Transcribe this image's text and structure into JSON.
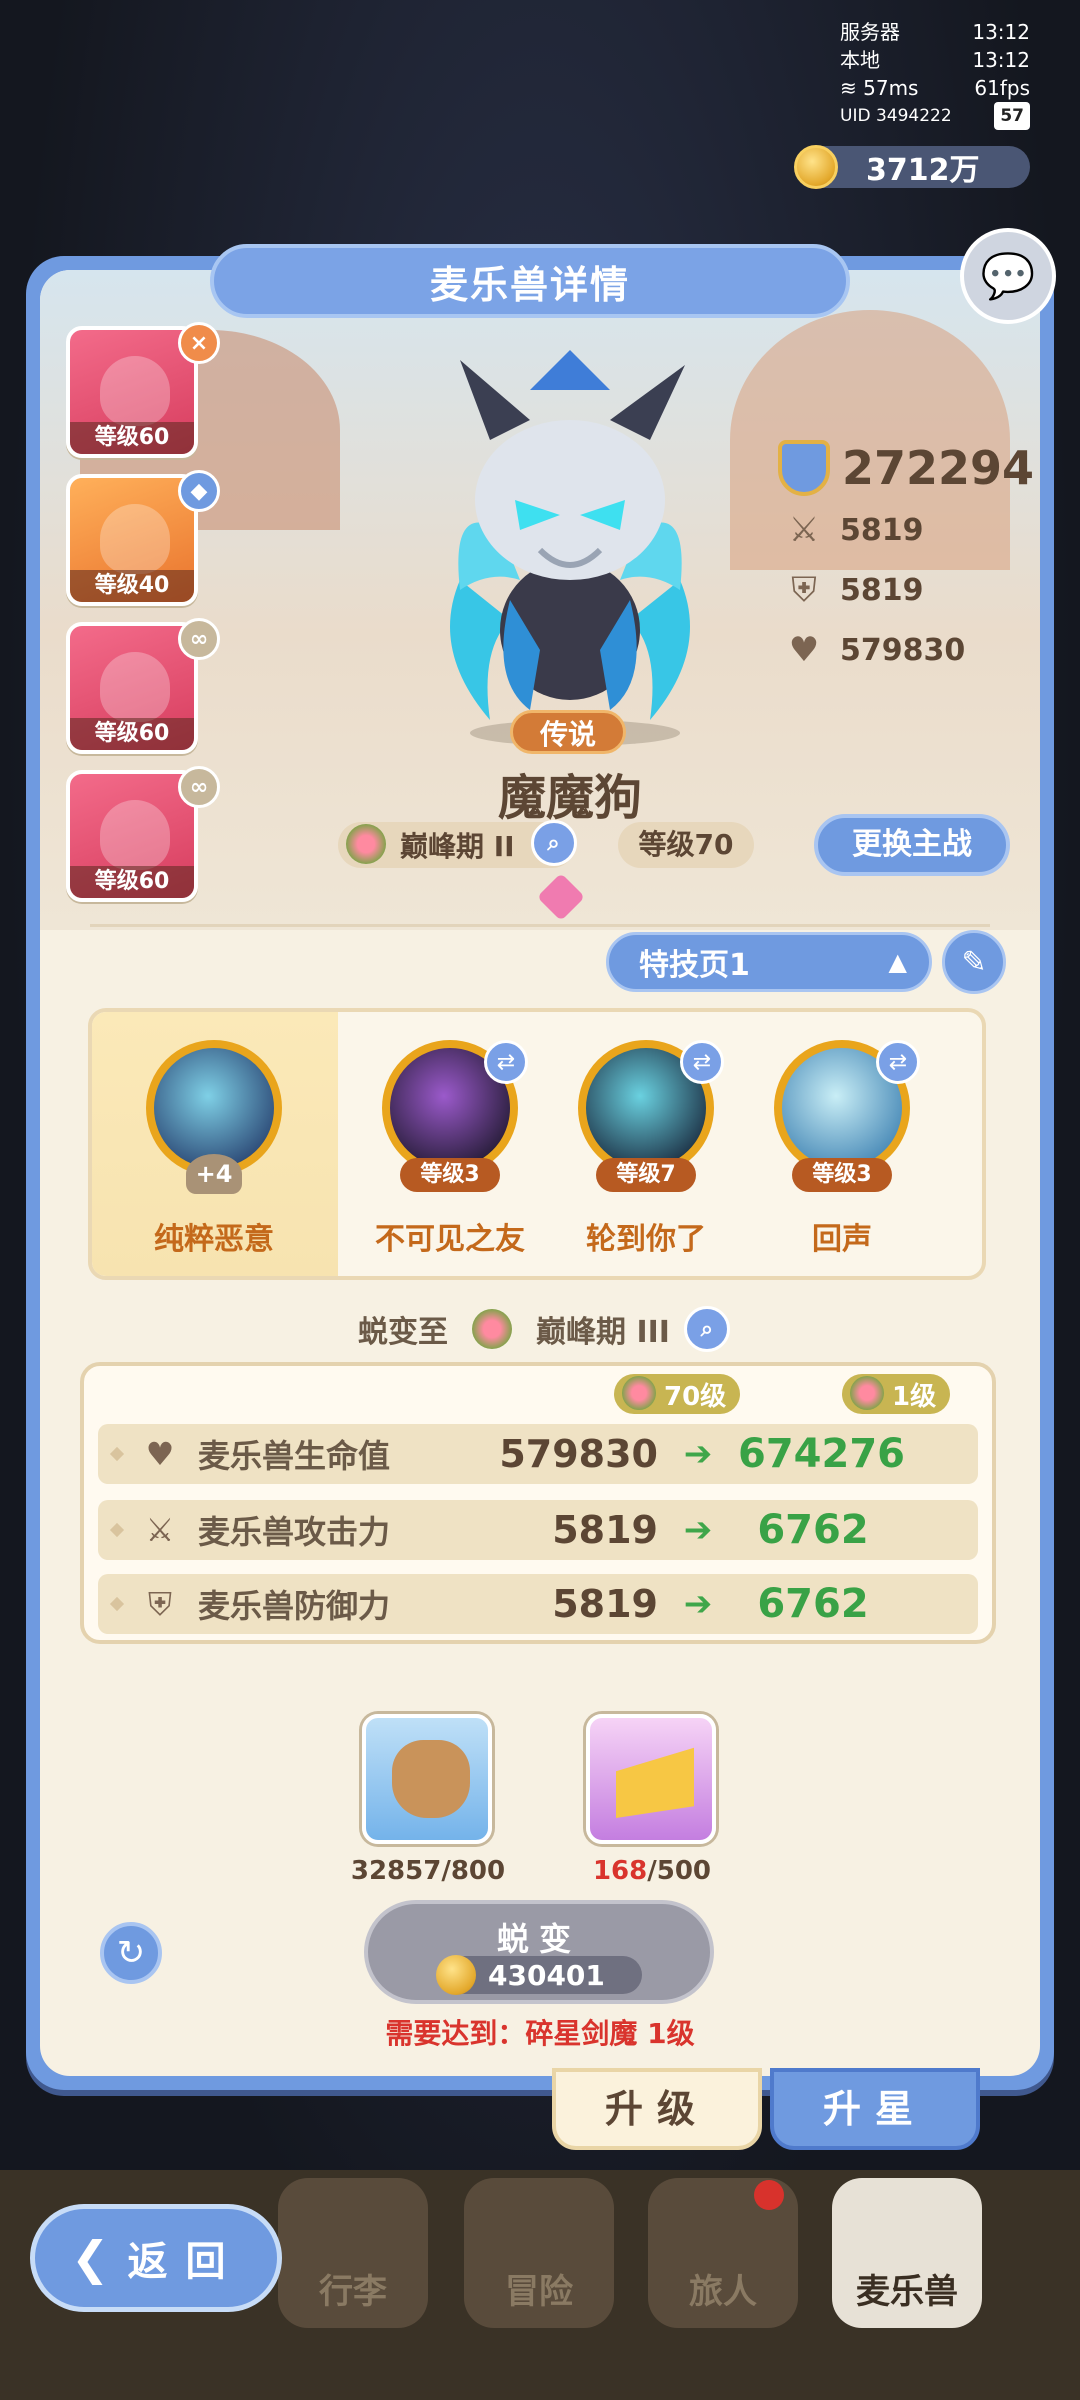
{
  "status": {
    "server_label": "服务器",
    "server_time": "13:12",
    "local_label": "本地",
    "local_time": "13:12",
    "ping": "57ms",
    "fps": "61fps",
    "uid": "UID 3494222",
    "battery": "57"
  },
  "currency": {
    "gold": "3712万"
  },
  "panel": {
    "title": "麦乐兽详情"
  },
  "team": [
    {
      "level": "等级60",
      "badge": "×",
      "badge_color": "#f08c4a"
    },
    {
      "level": "等级40",
      "badge": "◆",
      "badge_color": "#6f9ae0"
    },
    {
      "level": "等级60",
      "badge": "∞",
      "badge_color": "#c7b89c"
    },
    {
      "level": "等级60",
      "badge": "∞",
      "badge_color": "#c7b89c"
    }
  ],
  "pet": {
    "rarity": "传说",
    "name": "魔魔狗",
    "stage": "巅峰期 II",
    "level": "等级70",
    "switch_main": "更换主战",
    "power": "272294",
    "attack": "5819",
    "defense": "5819",
    "hp": "579830"
  },
  "skills": {
    "page": "特技页1",
    "main": {
      "name": "纯粹恶意",
      "plus": "+4"
    },
    "items": [
      {
        "name": "不可见之友",
        "level": "等级3"
      },
      {
        "name": "轮到你了",
        "level": "等级7"
      },
      {
        "name": "回声",
        "level": "等级3"
      }
    ]
  },
  "evolve": {
    "prefix": "蜕变至",
    "target": "巅峰期 III",
    "from_level": "70级",
    "to_level": "1级",
    "stats": [
      {
        "label": "麦乐兽生命值",
        "icon": "heart-icon",
        "from": "579830",
        "to": "674276"
      },
      {
        "label": "麦乐兽攻击力",
        "icon": "swords-icon",
        "from": "5819",
        "to": "6762"
      },
      {
        "label": "麦乐兽防御力",
        "icon": "shield-icon",
        "from": "5819",
        "to": "6762"
      }
    ],
    "materials": [
      {
        "name": "food-bag",
        "have": "32857",
        "need": "/800"
      },
      {
        "name": "cheese",
        "have": "168",
        "need": "/500"
      }
    ],
    "button": "蜕变",
    "cost": "430401",
    "requirement": "需要达到：碎星剑魔 1级"
  },
  "tabs": {
    "upgrade": "升级",
    "star": "升星"
  },
  "nav": {
    "back": "返回",
    "items": [
      "行李",
      "冒险",
      "旅人",
      "麦乐兽"
    ]
  }
}
